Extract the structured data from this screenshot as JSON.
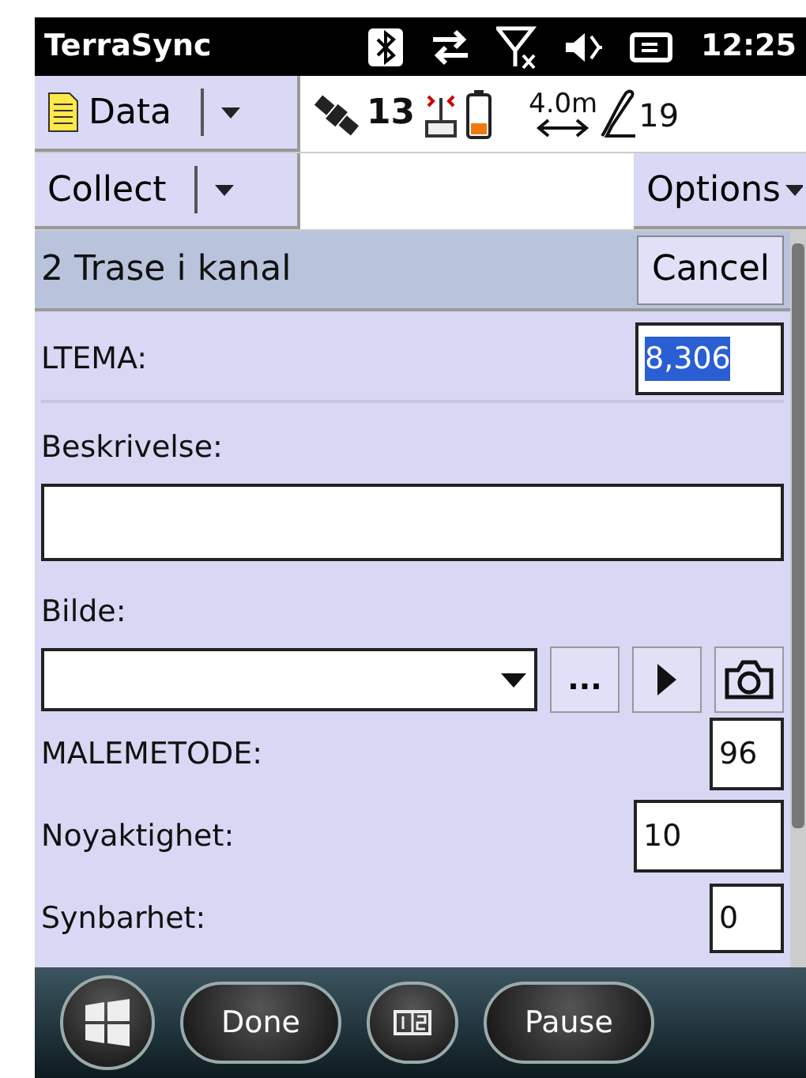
{
  "status_bar": {
    "title": "TerraSync",
    "time": "12:25"
  },
  "toolbar": {
    "data_menu": "Data",
    "satellites": "13",
    "accuracy": "4.0m",
    "count": "19"
  },
  "menu_bar": {
    "collect_menu": "Collect",
    "options_menu": "Options"
  },
  "form": {
    "title": "2 Trase i kanal",
    "cancel": "Cancel",
    "fields": [
      {
        "kind": "inline",
        "label": "LTEMA:",
        "value": "8,306",
        "selected": true
      },
      {
        "kind": "stacked",
        "label": "Beskrivelse:",
        "selected": false
      },
      {
        "kind": "picker",
        "label": "Bilde:",
        "browse": "...",
        "selected": false
      },
      {
        "kind": "inline",
        "label": "MALEMETODE:",
        "value": "96",
        "selected": false
      },
      {
        "kind": "inline",
        "label": "Noyaktighet:",
        "value": "10",
        "selected": false
      },
      {
        "kind": "inline",
        "label": "Synbarhet:",
        "value": "0",
        "selected": false
      }
    ]
  },
  "taskbar": {
    "done": "Done",
    "pause": "Pause"
  }
}
